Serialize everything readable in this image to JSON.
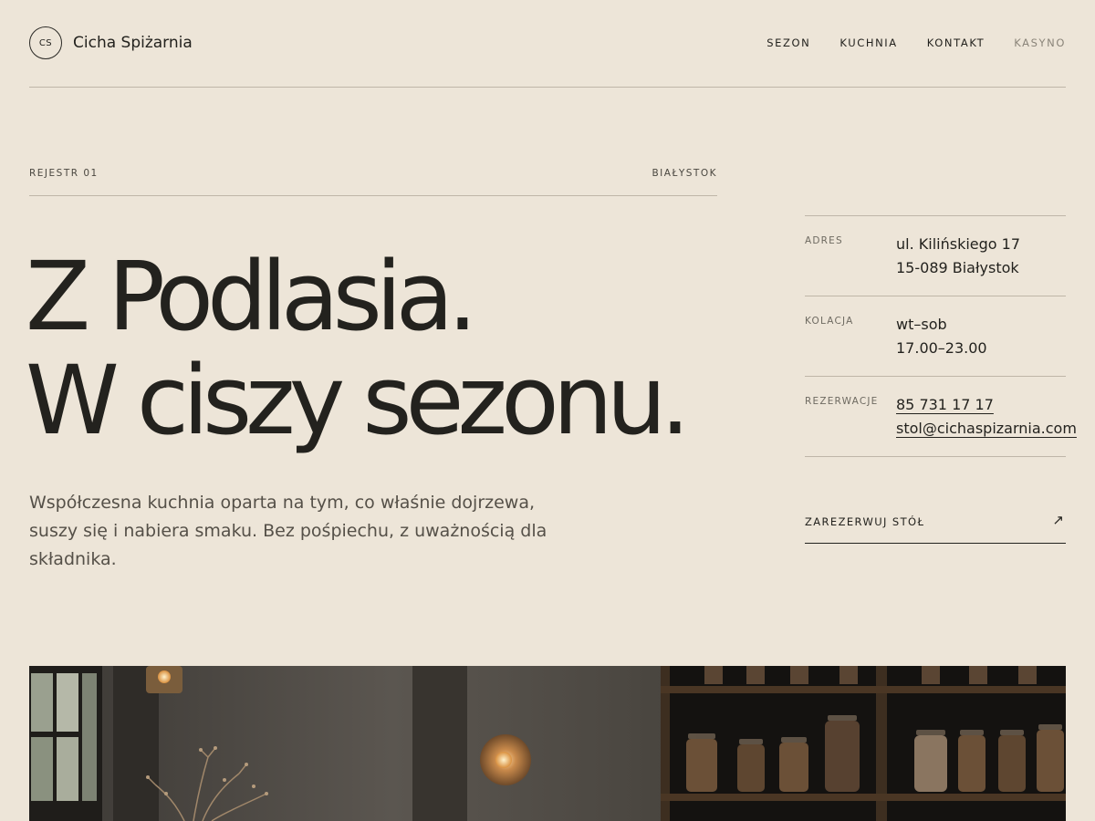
{
  "brand": {
    "monogram": "CS",
    "name": "Cicha Spiżarnia"
  },
  "nav": {
    "items": [
      "SEZON",
      "KUCHNIA",
      "KONTAKT",
      "KASYNO"
    ]
  },
  "hero": {
    "kicker_left": "REJESTR 01",
    "kicker_right": "BIAŁYSTOK",
    "title_line1": "Z Podlasia.",
    "title_line2": "W ciszy sezonu.",
    "lead": "Współczesna kuchnia oparta na tym, co właśnie dojrzewa, suszy się i nabiera smaku. Bez pośpiechu, z uważnością dla składnika."
  },
  "info": {
    "address": {
      "label": "ADRES",
      "line1": "ul. Kilińskiego 17",
      "line2": "15-089 Białystok"
    },
    "hours": {
      "label": "KOLACJA",
      "line1": "wt–sob",
      "line2": "17.00–23.00"
    },
    "reservations": {
      "label": "REZERWACJE",
      "phone": "85 731 17 17",
      "email": "stol@cichaspizarnia.com"
    }
  },
  "cta": {
    "label": "ZAREZERWUJ STÓŁ",
    "icon": "arrow-up-right-icon"
  },
  "photo": {
    "subject": "restaurant-interior-photo"
  },
  "colors": {
    "background": "#ede5d8",
    "text": "#23221e",
    "muted": "#8a8479",
    "rule": "#bfb6a8"
  }
}
